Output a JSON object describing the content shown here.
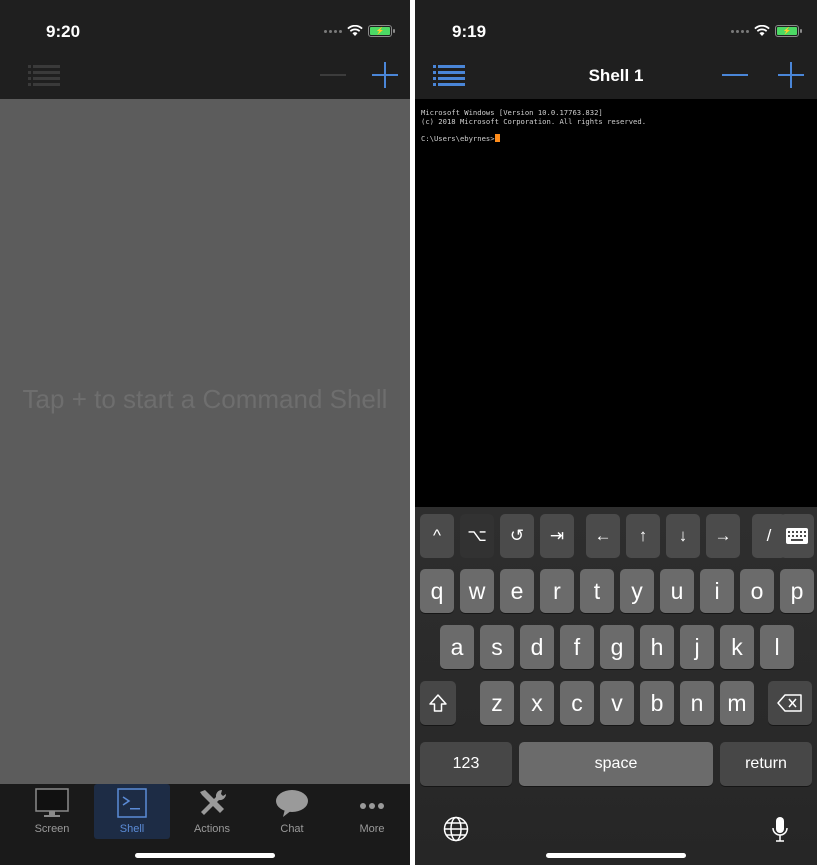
{
  "left_screen": {
    "status_time": "9:20",
    "empty_hint": "Tap + to start a Command Shell",
    "tabs": [
      {
        "label": "Screen",
        "icon": "monitor-icon"
      },
      {
        "label": "Shell",
        "icon": "terminal-icon",
        "active": true
      },
      {
        "label": "Actions",
        "icon": "tools-icon"
      },
      {
        "label": "Chat",
        "icon": "chat-bubble-icon"
      },
      {
        "label": "More",
        "icon": "more-dots-icon"
      }
    ]
  },
  "right_screen": {
    "status_time": "9:19",
    "nav_title": "Shell 1",
    "terminal": {
      "line1": "Microsoft Windows [Version 10.0.17763.832]",
      "line2": "(c) 2018 Microsoft Corporation. All rights reserved.",
      "prompt": "C:\\Users\\ebyrnes>"
    },
    "accessory_keys": [
      "^",
      "⌥",
      "↺",
      "⇥",
      "←",
      "↑",
      "↓",
      "→",
      "/"
    ],
    "keyboard": {
      "row1": [
        "q",
        "w",
        "e",
        "r",
        "t",
        "y",
        "u",
        "i",
        "o",
        "p"
      ],
      "row2": [
        "a",
        "s",
        "d",
        "f",
        "g",
        "h",
        "j",
        "k",
        "l"
      ],
      "row3": [
        "z",
        "x",
        "c",
        "v",
        "b",
        "n",
        "m"
      ],
      "numbers_label": "123",
      "space_label": "space",
      "return_label": "return"
    }
  },
  "colors": {
    "accent": "#4a86d8",
    "cursor": "#ff8c1a",
    "battery": "#4cd964"
  }
}
